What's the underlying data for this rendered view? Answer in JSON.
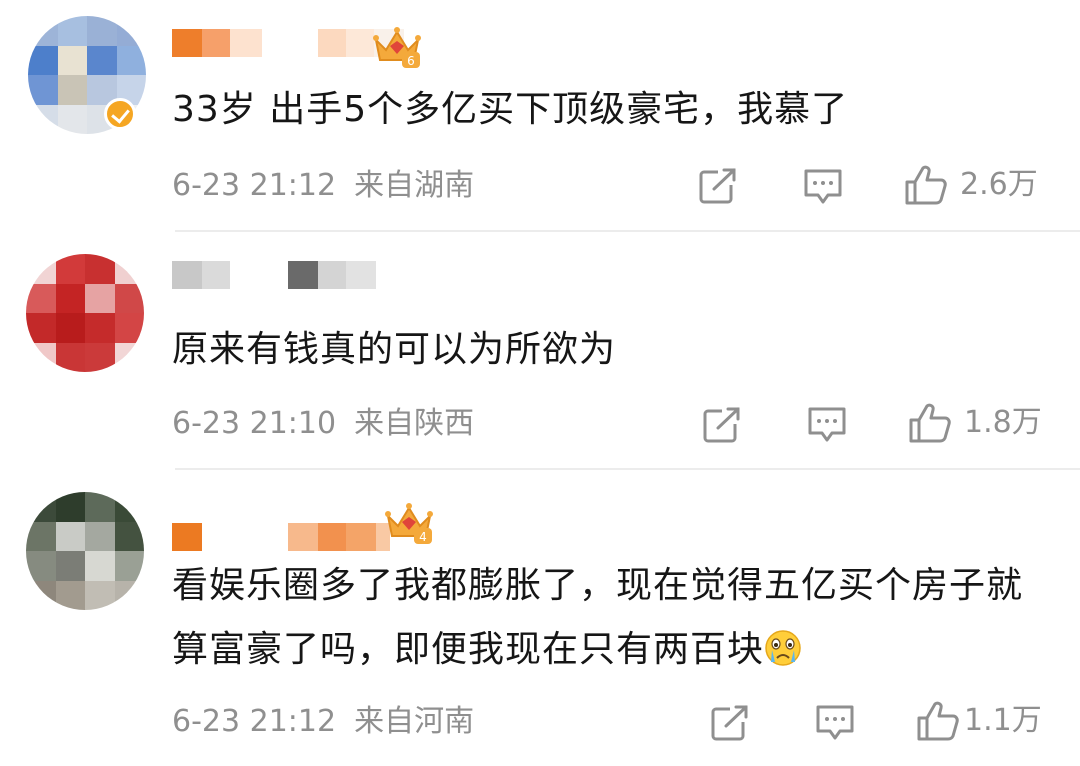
{
  "comments": [
    {
      "text": "33岁 出手5个多亿买下顶级豪宅，我慕了",
      "time": "6-23 21:12",
      "location": "来自湖南",
      "likes": "2.6万",
      "crown_level": "6",
      "verified": true
    },
    {
      "text": "原来有钱真的可以为所欲为",
      "time": "6-23 21:10",
      "location": "来自陕西",
      "likes": "1.8万"
    },
    {
      "text": "看娱乐圈多了我都膨胀了，现在觉得五亿买个房子就算富豪了吗，即便我现在只有两百块",
      "time": "6-23 21:12",
      "location": "来自河南",
      "likes": "1.1万",
      "crown_level": "4",
      "emoji": "crying-face"
    }
  ],
  "icons": {
    "share": "share-icon",
    "comment": "comment-icon",
    "like": "thumbs-up-icon",
    "crown": "crown-badge-icon",
    "verified": "verified-badge-icon"
  },
  "colors": {
    "crown": "#f4a93b",
    "crown_gem": "#e0453a",
    "verified": "#f5a623",
    "meta_text": "#8f8f8f",
    "divider": "#ececec"
  }
}
